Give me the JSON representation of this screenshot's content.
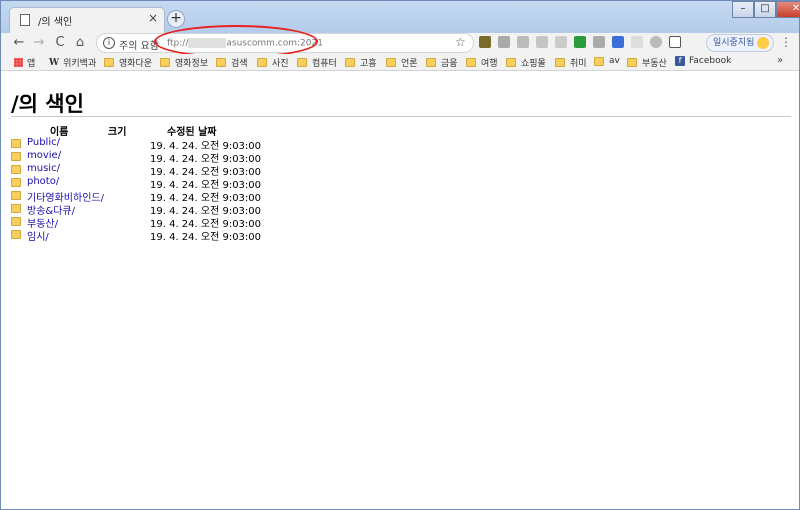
{
  "tab": {
    "title": "/의 색인",
    "close": "×",
    "new_tab": "+"
  },
  "window_controls": {
    "minimize": "–",
    "maximize": "□",
    "close": "✕"
  },
  "toolbar": {
    "back": "←",
    "forward": "→",
    "reload": "C",
    "home": "⌂",
    "security_label": "주의 요함",
    "url_scheme": "ftp://",
    "url_host": "asuscomm.com:2021",
    "star": "☆",
    "profile_label": "일시중지됨",
    "menu": "⋮"
  },
  "bookmarks": [
    {
      "label": "앱",
      "icon": "apps-icon"
    },
    {
      "label": "위키백과",
      "icon": "wikipedia-icon"
    },
    {
      "label": "영화다운",
      "icon": "folder-icon"
    },
    {
      "label": "영화정보",
      "icon": "folder-icon"
    },
    {
      "label": "검색",
      "icon": "folder-icon"
    },
    {
      "label": "사진",
      "icon": "folder-icon"
    },
    {
      "label": "컴퓨터",
      "icon": "folder-icon"
    },
    {
      "label": "고흥",
      "icon": "folder-icon"
    },
    {
      "label": "언론",
      "icon": "folder-icon"
    },
    {
      "label": "금융",
      "icon": "folder-icon"
    },
    {
      "label": "여행",
      "icon": "folder-icon"
    },
    {
      "label": "쇼핑몰",
      "icon": "folder-icon"
    },
    {
      "label": "취미",
      "icon": "folder-icon"
    },
    {
      "label": "av",
      "icon": "folder-icon"
    },
    {
      "label": "부동산",
      "icon": "folder-icon"
    },
    {
      "label": "Facebook",
      "icon": "facebook-icon"
    }
  ],
  "bookmarks_more": "»",
  "listing": {
    "title": "/의 색인",
    "headers": {
      "name": "이름",
      "size": "크기",
      "modified": "수정된 날짜"
    },
    "rows": [
      {
        "name": "Public/",
        "date": "19. 4. 24. 오전 9:03:00"
      },
      {
        "name": "movie/",
        "date": "19. 4. 24. 오전 9:03:00"
      },
      {
        "name": "music/",
        "date": "19. 4. 24. 오전 9:03:00"
      },
      {
        "name": "photo/",
        "date": "19. 4. 24. 오전 9:03:00"
      },
      {
        "name": "기타영화비하인드/",
        "date": "19. 4. 24. 오전 9:03:00"
      },
      {
        "name": "방송&다큐/",
        "date": "19. 4. 24. 오전 9:03:00"
      },
      {
        "name": "부동산/",
        "date": "19. 4. 24. 오전 9:03:00"
      },
      {
        "name": "임시/",
        "date": "19. 4. 24. 오전 9:03:00"
      }
    ]
  }
}
